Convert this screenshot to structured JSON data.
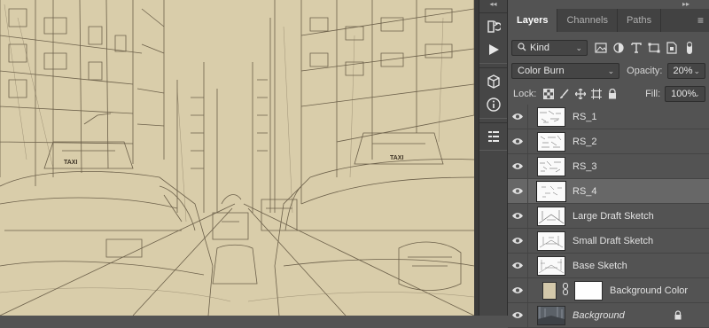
{
  "panel": {
    "tabs": [
      {
        "label": "Layers",
        "active": true
      },
      {
        "label": "Channels",
        "active": false
      },
      {
        "label": "Paths",
        "active": false
      }
    ],
    "filter": {
      "kind_label": "Kind"
    },
    "blend_mode": "Color Burn",
    "opacity_label": "Opacity:",
    "opacity_value": "20%",
    "lock_label": "Lock:",
    "fill_label": "Fill:",
    "fill_value": "100%"
  },
  "layers": [
    {
      "name": "RS_1",
      "selected": false,
      "italic": false
    },
    {
      "name": "RS_2",
      "selected": false,
      "italic": false
    },
    {
      "name": "RS_3",
      "selected": false,
      "italic": false
    },
    {
      "name": "RS_4",
      "selected": true,
      "italic": false
    },
    {
      "name": "Large Draft Sketch",
      "selected": false,
      "italic": false
    },
    {
      "name": "Small Draft Sketch",
      "selected": false,
      "italic": false
    },
    {
      "name": "Base Sketch",
      "selected": false,
      "italic": false
    },
    {
      "name": "Background Color",
      "selected": false,
      "italic": false
    },
    {
      "name": "Background",
      "selected": false,
      "italic": true
    }
  ],
  "colors": {
    "canvas_paper": "#d9cdaa",
    "sketch_line": "#5a4e3a",
    "panel_bg": "#535353",
    "selected_row": "#676767",
    "fill_swatch": "#d3c8aa"
  },
  "icons": {
    "toolstrip": [
      "history-icon",
      "play-icon",
      "3d-cube-icon",
      "info-icon",
      "properties-icon"
    ],
    "filters": [
      "image-filter-icon",
      "adjustment-filter-icon",
      "type-filter-icon",
      "shape-filter-icon",
      "smart-object-filter-icon",
      "filter-toggle-icon"
    ],
    "locks": [
      "lock-transparent-icon",
      "lock-paint-icon",
      "lock-position-icon",
      "lock-artboard-icon",
      "lock-all-icon"
    ]
  }
}
